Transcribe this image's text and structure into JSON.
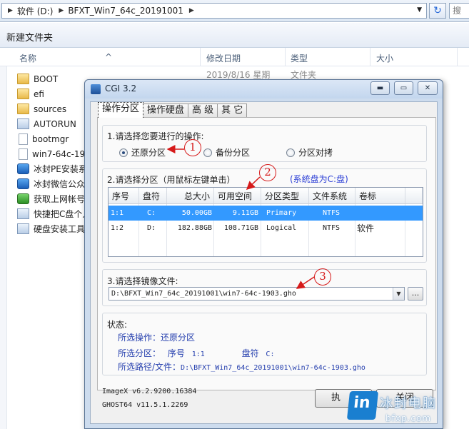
{
  "explorer": {
    "path_segments": [
      "软件 (D:)",
      "BFXT_Win7_64c_20191001"
    ],
    "refresh_glyph": "↻",
    "search_placeholder": "搜",
    "new_folder_label": "新建文件夹",
    "columns": {
      "name": "名称",
      "date": "修改日期",
      "type": "类型",
      "size": "大小"
    },
    "first_row_date": "2019/8/16 星期",
    "first_row_type": "文件夹",
    "items": [
      {
        "name": "BOOT",
        "icon": "folder-icon"
      },
      {
        "name": "efi",
        "icon": "folder-icon"
      },
      {
        "name": "sources",
        "icon": "folder-icon"
      },
      {
        "name": "AUTORUN",
        "icon": "settings-file-icon"
      },
      {
        "name": "bootmgr",
        "icon": "file-icon"
      },
      {
        "name": "win7-64c-19",
        "icon": "file-icon"
      },
      {
        "name": "冰封PE安装系",
        "icon": "app-icon"
      },
      {
        "name": "冰封微信公众",
        "icon": "app-icon"
      },
      {
        "name": "获取上网帐号",
        "icon": "app-icon"
      },
      {
        "name": "快捷把C盘个人",
        "icon": "app-icon"
      },
      {
        "name": "硬盘安装工具",
        "icon": "app-icon"
      }
    ]
  },
  "dialog": {
    "title": "CGI 3.2",
    "caption": {
      "min": "▬",
      "max": "▭",
      "close": "✕"
    },
    "tabs": [
      "操作分区",
      "操作硬盘",
      "高 级",
      "其 它"
    ],
    "step1": {
      "title": "1.请选择您要进行的操作:",
      "options": [
        "还原分区",
        "备份分区",
        "分区对拷"
      ],
      "selected": 0
    },
    "step2": {
      "title": "2.请选择分区（用鼠标左键单击）",
      "system_note": "(系统盘为C:盘)",
      "headers": [
        "序号",
        "盘符",
        "总大小",
        "可用空间",
        "分区类型",
        "文件系统",
        "卷标"
      ],
      "rows": [
        [
          "1:1",
          "C:",
          "50.00GB",
          "9.11GB",
          "Primary",
          "NTFS",
          ""
        ],
        [
          "1:2",
          "D:",
          "182.88GB",
          "108.71GB",
          "Logical",
          "NTFS",
          "软件"
        ]
      ],
      "selected_row": 0
    },
    "step3": {
      "title": "3.请选择镜像文件:",
      "image_path": "D:\\BFXT_Win7_64c_20191001\\win7-64c-1903.gho",
      "dropdown_glyph": "▼",
      "browse_label": "..."
    },
    "status": {
      "title": "状态:",
      "operation_label": "所选操作：",
      "operation_value": "还原分区",
      "partition_label": "所选分区：",
      "partition_index_label": "序号",
      "partition_index": "1:1",
      "drive_label": "盘符",
      "drive_value": "C:",
      "path_label": "所选路径/文件：",
      "path_value": "D:\\BFXT_Win7_64c_20191001\\win7-64c-1903.gho"
    },
    "versions": [
      "ImageX v6.2.9200.16384",
      "GHOST64 v11.5.1.2269"
    ],
    "execute_label": "执",
    "close_label": "关闭"
  },
  "annotations": [
    "1",
    "2",
    "3"
  ],
  "annotation_color": "#d61a1a",
  "selection_color": "#3399ff",
  "watermark": {
    "logo": "in",
    "text": "冰封电脑",
    "url": "bfxp.com"
  }
}
